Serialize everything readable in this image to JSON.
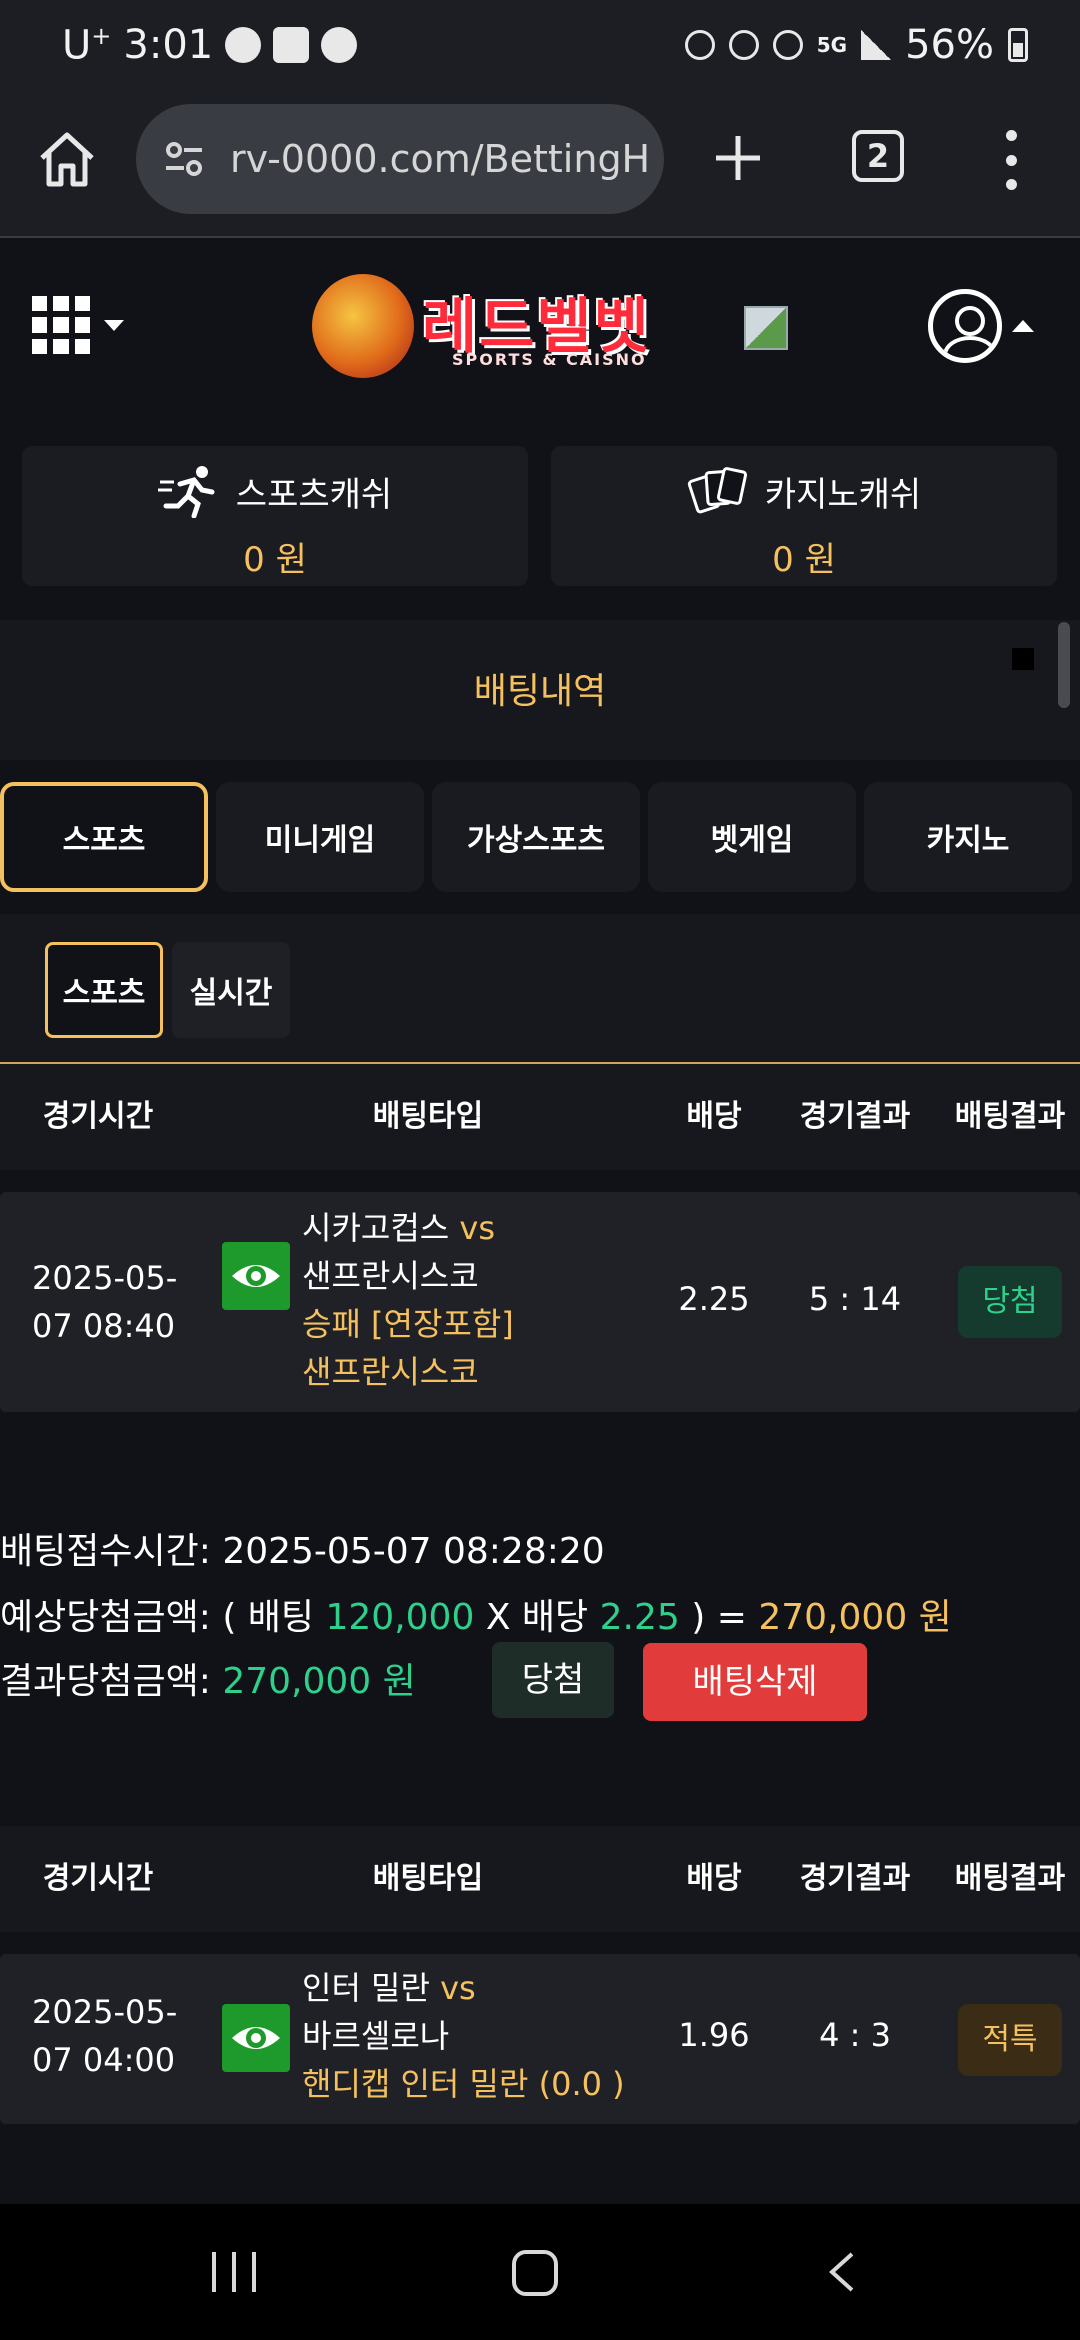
{
  "status_bar": {
    "carrier": "U",
    "carrier_sup": "+",
    "time": "3:01",
    "network": "5G",
    "battery": "56%"
  },
  "browser": {
    "url": "rv-0000.com/BettingH",
    "tab_count": "2"
  },
  "header": {
    "logo_title": "레드벨벳",
    "logo_subtitle": "SPORTS & CAISNO"
  },
  "wallet": {
    "sports_label": "스포츠캐쉬",
    "sports_value": "0 원",
    "casino_label": "카지노캐쉬",
    "casino_value": "0 원"
  },
  "page_title": "배팅내역",
  "main_tabs": [
    {
      "label": "스포츠",
      "active": true
    },
    {
      "label": "미니게임",
      "active": false
    },
    {
      "label": "가상스포츠",
      "active": false
    },
    {
      "label": "벳게임",
      "active": false
    },
    {
      "label": "카지노",
      "active": false
    }
  ],
  "sub_tabs": [
    {
      "label": "스포츠",
      "active": true
    },
    {
      "label": "실시간",
      "active": false
    }
  ],
  "table_headers": [
    "경기시간",
    "배팅타입",
    "배당",
    "경기결과",
    "배팅결과"
  ],
  "bets": [
    {
      "time_line1": "2025-05-",
      "time_line2": "07 08:40",
      "home": "시카고컵스",
      "vs": "vs",
      "away": "샌프란시스코",
      "market": "승패 [연장포함]",
      "pick": "샌프란시스코",
      "odds": "2.25",
      "score": "5 : 14",
      "result": "당첨",
      "receipt": {
        "accepted_label": "배팅접수시간:",
        "accepted_value": "2025-05-07 08:28:20",
        "expected_label": "예상당첨금액:",
        "paren_open": "( 배팅",
        "stake": "120,000",
        "x_odds": "X 배당",
        "odds": "2.25",
        "paren_close": ") =",
        "expected_value": "270,000 원",
        "result_label": "결과당첨금액:",
        "result_value": "270,000 원",
        "status": "당첨",
        "delete_label": "배팅삭제"
      }
    },
    {
      "time_line1": "2025-05-",
      "time_line2": "07 04:00",
      "home": "인터 밀란",
      "vs": "vs",
      "away": "바르셀로나",
      "market": "핸디캡 인터 밀란 (0.0 )",
      "odds": "1.96",
      "score": "4 : 3",
      "result": "적특"
    }
  ],
  "colors": {
    "accent": "#f5c15e",
    "win": "#2ed18b",
    "delete": "#e23b3b",
    "eye": "#1d9a2b"
  },
  "icons": [
    "home-icon",
    "tune-icon",
    "plus-icon",
    "more-icon",
    "grid-menu-icon",
    "user-icon",
    "eye-icon",
    "runner-icon",
    "cards-icon"
  ]
}
